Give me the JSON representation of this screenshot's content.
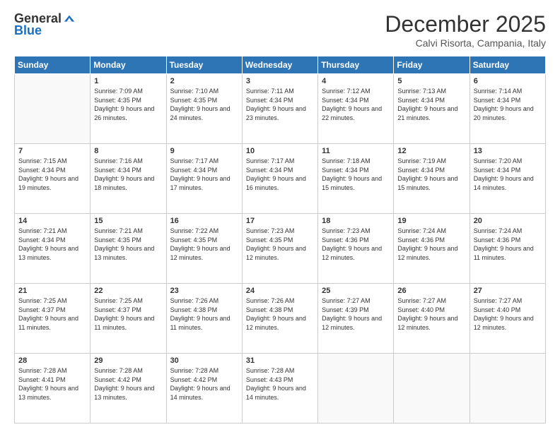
{
  "logo": {
    "general": "General",
    "blue": "Blue"
  },
  "title": "December 2025",
  "location": "Calvi Risorta, Campania, Italy",
  "days_of_week": [
    "Sunday",
    "Monday",
    "Tuesday",
    "Wednesday",
    "Thursday",
    "Friday",
    "Saturday"
  ],
  "weeks": [
    [
      {
        "day": "",
        "sunrise": "",
        "sunset": "",
        "daylight": ""
      },
      {
        "day": "1",
        "sunrise": "Sunrise: 7:09 AM",
        "sunset": "Sunset: 4:35 PM",
        "daylight": "Daylight: 9 hours and 26 minutes."
      },
      {
        "day": "2",
        "sunrise": "Sunrise: 7:10 AM",
        "sunset": "Sunset: 4:35 PM",
        "daylight": "Daylight: 9 hours and 24 minutes."
      },
      {
        "day": "3",
        "sunrise": "Sunrise: 7:11 AM",
        "sunset": "Sunset: 4:34 PM",
        "daylight": "Daylight: 9 hours and 23 minutes."
      },
      {
        "day": "4",
        "sunrise": "Sunrise: 7:12 AM",
        "sunset": "Sunset: 4:34 PM",
        "daylight": "Daylight: 9 hours and 22 minutes."
      },
      {
        "day": "5",
        "sunrise": "Sunrise: 7:13 AM",
        "sunset": "Sunset: 4:34 PM",
        "daylight": "Daylight: 9 hours and 21 minutes."
      },
      {
        "day": "6",
        "sunrise": "Sunrise: 7:14 AM",
        "sunset": "Sunset: 4:34 PM",
        "daylight": "Daylight: 9 hours and 20 minutes."
      }
    ],
    [
      {
        "day": "7",
        "sunrise": "Sunrise: 7:15 AM",
        "sunset": "Sunset: 4:34 PM",
        "daylight": "Daylight: 9 hours and 19 minutes."
      },
      {
        "day": "8",
        "sunrise": "Sunrise: 7:16 AM",
        "sunset": "Sunset: 4:34 PM",
        "daylight": "Daylight: 9 hours and 18 minutes."
      },
      {
        "day": "9",
        "sunrise": "Sunrise: 7:17 AM",
        "sunset": "Sunset: 4:34 PM",
        "daylight": "Daylight: 9 hours and 17 minutes."
      },
      {
        "day": "10",
        "sunrise": "Sunrise: 7:17 AM",
        "sunset": "Sunset: 4:34 PM",
        "daylight": "Daylight: 9 hours and 16 minutes."
      },
      {
        "day": "11",
        "sunrise": "Sunrise: 7:18 AM",
        "sunset": "Sunset: 4:34 PM",
        "daylight": "Daylight: 9 hours and 15 minutes."
      },
      {
        "day": "12",
        "sunrise": "Sunrise: 7:19 AM",
        "sunset": "Sunset: 4:34 PM",
        "daylight": "Daylight: 9 hours and 15 minutes."
      },
      {
        "day": "13",
        "sunrise": "Sunrise: 7:20 AM",
        "sunset": "Sunset: 4:34 PM",
        "daylight": "Daylight: 9 hours and 14 minutes."
      }
    ],
    [
      {
        "day": "14",
        "sunrise": "Sunrise: 7:21 AM",
        "sunset": "Sunset: 4:34 PM",
        "daylight": "Daylight: 9 hours and 13 minutes."
      },
      {
        "day": "15",
        "sunrise": "Sunrise: 7:21 AM",
        "sunset": "Sunset: 4:35 PM",
        "daylight": "Daylight: 9 hours and 13 minutes."
      },
      {
        "day": "16",
        "sunrise": "Sunrise: 7:22 AM",
        "sunset": "Sunset: 4:35 PM",
        "daylight": "Daylight: 9 hours and 12 minutes."
      },
      {
        "day": "17",
        "sunrise": "Sunrise: 7:23 AM",
        "sunset": "Sunset: 4:35 PM",
        "daylight": "Daylight: 9 hours and 12 minutes."
      },
      {
        "day": "18",
        "sunrise": "Sunrise: 7:23 AM",
        "sunset": "Sunset: 4:36 PM",
        "daylight": "Daylight: 9 hours and 12 minutes."
      },
      {
        "day": "19",
        "sunrise": "Sunrise: 7:24 AM",
        "sunset": "Sunset: 4:36 PM",
        "daylight": "Daylight: 9 hours and 12 minutes."
      },
      {
        "day": "20",
        "sunrise": "Sunrise: 7:24 AM",
        "sunset": "Sunset: 4:36 PM",
        "daylight": "Daylight: 9 hours and 11 minutes."
      }
    ],
    [
      {
        "day": "21",
        "sunrise": "Sunrise: 7:25 AM",
        "sunset": "Sunset: 4:37 PM",
        "daylight": "Daylight: 9 hours and 11 minutes."
      },
      {
        "day": "22",
        "sunrise": "Sunrise: 7:25 AM",
        "sunset": "Sunset: 4:37 PM",
        "daylight": "Daylight: 9 hours and 11 minutes."
      },
      {
        "day": "23",
        "sunrise": "Sunrise: 7:26 AM",
        "sunset": "Sunset: 4:38 PM",
        "daylight": "Daylight: 9 hours and 11 minutes."
      },
      {
        "day": "24",
        "sunrise": "Sunrise: 7:26 AM",
        "sunset": "Sunset: 4:38 PM",
        "daylight": "Daylight: 9 hours and 12 minutes."
      },
      {
        "day": "25",
        "sunrise": "Sunrise: 7:27 AM",
        "sunset": "Sunset: 4:39 PM",
        "daylight": "Daylight: 9 hours and 12 minutes."
      },
      {
        "day": "26",
        "sunrise": "Sunrise: 7:27 AM",
        "sunset": "Sunset: 4:40 PM",
        "daylight": "Daylight: 9 hours and 12 minutes."
      },
      {
        "day": "27",
        "sunrise": "Sunrise: 7:27 AM",
        "sunset": "Sunset: 4:40 PM",
        "daylight": "Daylight: 9 hours and 12 minutes."
      }
    ],
    [
      {
        "day": "28",
        "sunrise": "Sunrise: 7:28 AM",
        "sunset": "Sunset: 4:41 PM",
        "daylight": "Daylight: 9 hours and 13 minutes."
      },
      {
        "day": "29",
        "sunrise": "Sunrise: 7:28 AM",
        "sunset": "Sunset: 4:42 PM",
        "daylight": "Daylight: 9 hours and 13 minutes."
      },
      {
        "day": "30",
        "sunrise": "Sunrise: 7:28 AM",
        "sunset": "Sunset: 4:42 PM",
        "daylight": "Daylight: 9 hours and 14 minutes."
      },
      {
        "day": "31",
        "sunrise": "Sunrise: 7:28 AM",
        "sunset": "Sunset: 4:43 PM",
        "daylight": "Daylight: 9 hours and 14 minutes."
      },
      {
        "day": "",
        "sunrise": "",
        "sunset": "",
        "daylight": ""
      },
      {
        "day": "",
        "sunrise": "",
        "sunset": "",
        "daylight": ""
      },
      {
        "day": "",
        "sunrise": "",
        "sunset": "",
        "daylight": ""
      }
    ]
  ]
}
